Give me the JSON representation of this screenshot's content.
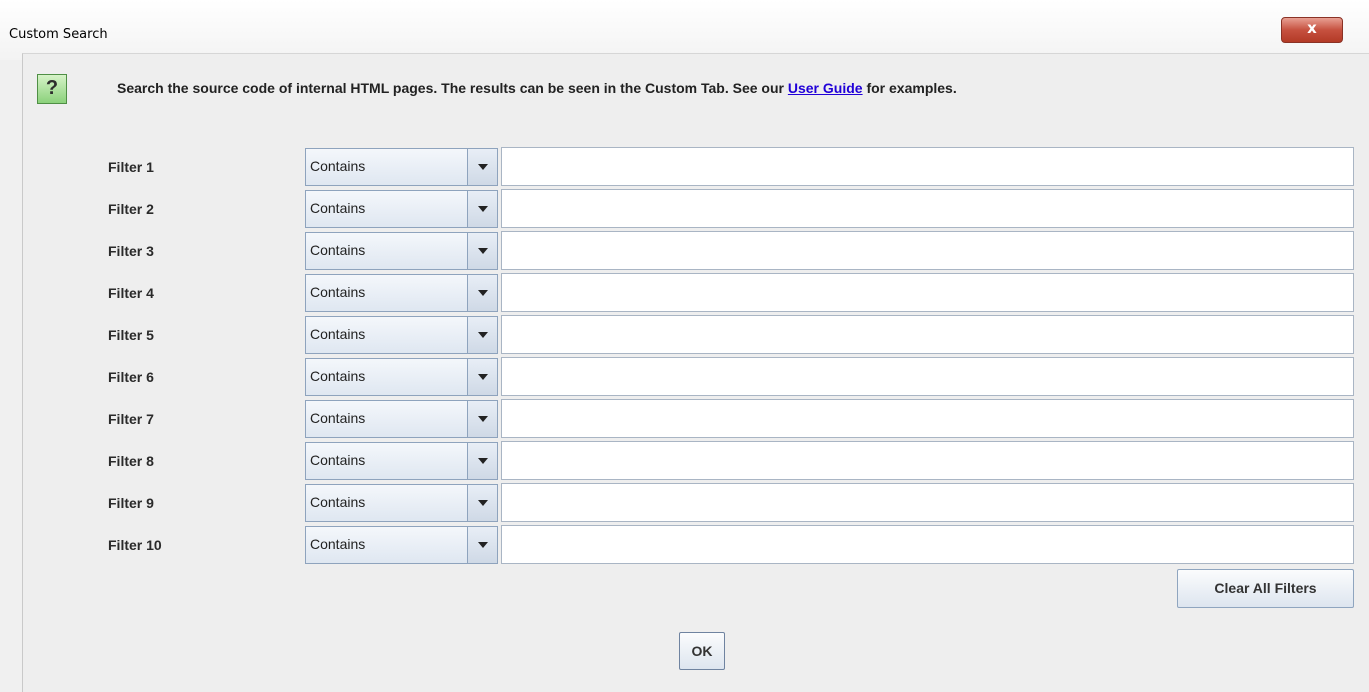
{
  "window": {
    "title": "Custom Search",
    "close_label": "x"
  },
  "help_icon": "?",
  "description": {
    "before_link": "Search the source code of internal HTML pages. The results can be seen in the Custom Tab. See our ",
    "link_text": "User Guide",
    "after_link": " for examples."
  },
  "filters": [
    {
      "label": "Filter 1",
      "operator": "Contains",
      "value": ""
    },
    {
      "label": "Filter 2",
      "operator": "Contains",
      "value": ""
    },
    {
      "label": "Filter 3",
      "operator": "Contains",
      "value": ""
    },
    {
      "label": "Filter 4",
      "operator": "Contains",
      "value": ""
    },
    {
      "label": "Filter 5",
      "operator": "Contains",
      "value": ""
    },
    {
      "label": "Filter 6",
      "operator": "Contains",
      "value": ""
    },
    {
      "label": "Filter 7",
      "operator": "Contains",
      "value": ""
    },
    {
      "label": "Filter 8",
      "operator": "Contains",
      "value": ""
    },
    {
      "label": "Filter 9",
      "operator": "Contains",
      "value": ""
    },
    {
      "label": "Filter 10",
      "operator": "Contains",
      "value": ""
    }
  ],
  "buttons": {
    "clear_all": "Clear All Filters",
    "ok": "OK"
  }
}
